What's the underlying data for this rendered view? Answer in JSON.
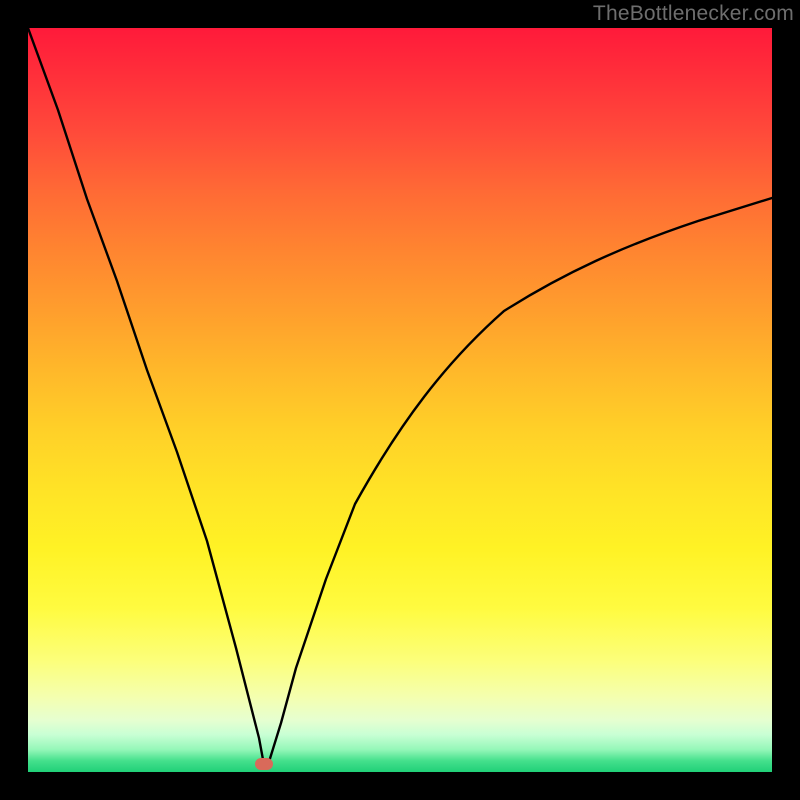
{
  "watermark": "TheBottlenecker.com",
  "chart_data": {
    "type": "line",
    "title": "",
    "xlabel": "",
    "ylabel": "",
    "xlim": [
      0,
      100
    ],
    "ylim": [
      0,
      100
    ],
    "background_gradient": {
      "top": "#ff1a3a",
      "mid": "#ffe326",
      "bottom": "#20d078",
      "meaning": "red=high bottleneck, green=low bottleneck"
    },
    "marker": {
      "x": 32,
      "y": 2,
      "color": "#d96a5a",
      "shape": "rounded-rect"
    },
    "series": [
      {
        "name": "bottleneck-curve",
        "x": [
          0,
          4,
          8,
          12,
          16,
          20,
          24,
          28,
          31,
          32,
          34,
          36,
          40,
          44,
          50,
          56,
          64,
          72,
          80,
          90,
          100
        ],
        "values": [
          100,
          89,
          77,
          66,
          54,
          43,
          31,
          16,
          4,
          1,
          6,
          14,
          26,
          36,
          47,
          55,
          62,
          67,
          71,
          74,
          77
        ]
      }
    ]
  }
}
